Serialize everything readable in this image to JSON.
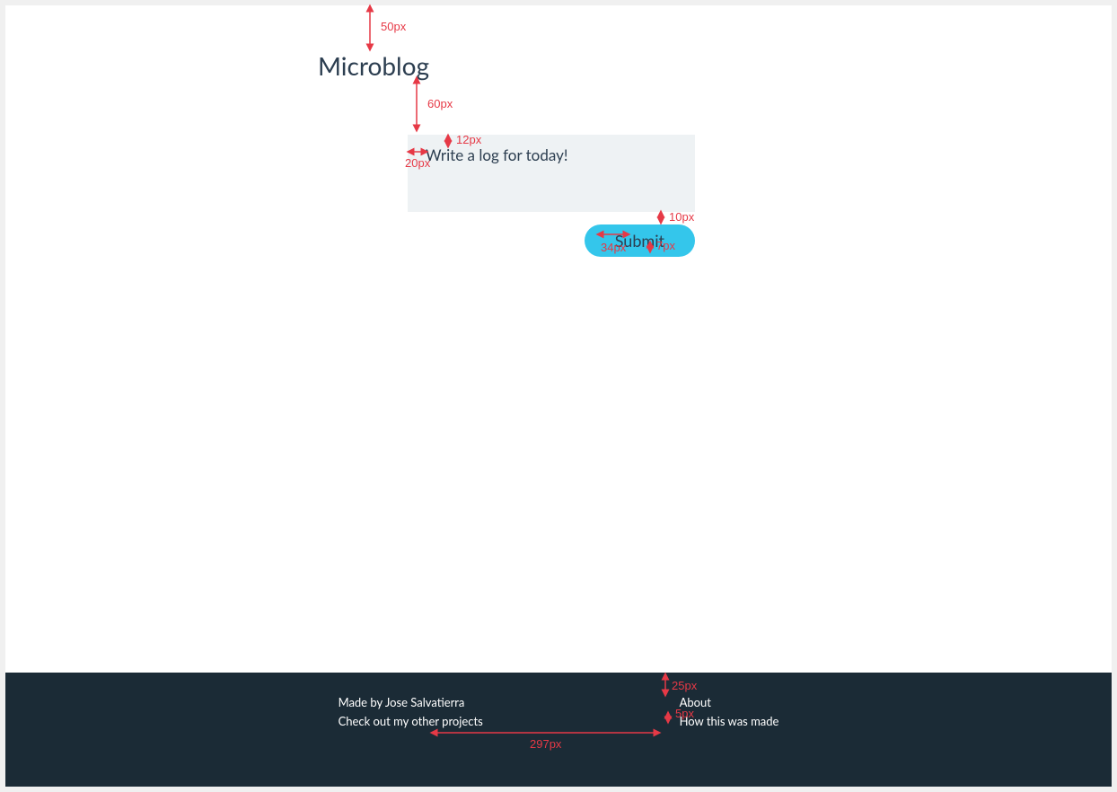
{
  "title": "Microblog",
  "form": {
    "placeholder": "Write a log for today!",
    "submit_label": "Submit"
  },
  "footer": {
    "left": [
      "Made by Jose Salvatierra",
      "Check out my other projects"
    ],
    "right": [
      "About",
      "How this was made"
    ]
  },
  "annotations": {
    "a1": "50px",
    "a2": "60px",
    "a3": "12px",
    "a4": "20px",
    "a5": "10px",
    "a6": "34px",
    "a7": "7px",
    "a8": "25px",
    "a9": "5px",
    "a10": "297px"
  }
}
